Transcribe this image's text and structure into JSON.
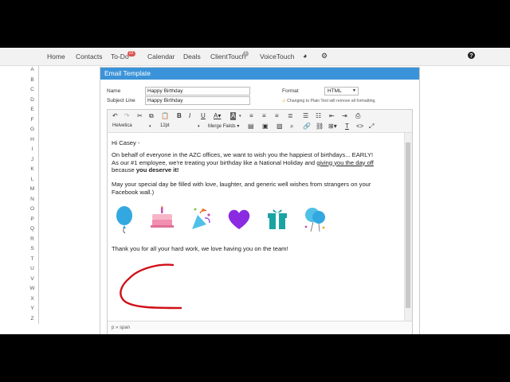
{
  "nav": {
    "items": [
      {
        "label": "Home"
      },
      {
        "label": "Contacts"
      },
      {
        "label": "To-Do",
        "badge": "22"
      },
      {
        "label": "Calendar"
      },
      {
        "label": "Deals"
      },
      {
        "label": "ClientTouch",
        "badge": "1"
      },
      {
        "label": "VoiceTouch"
      }
    ],
    "icons": [
      "pie-chart-icon",
      "gear-icon",
      "help-icon"
    ]
  },
  "alphabet": [
    "A",
    "B",
    "C",
    "D",
    "E",
    "F",
    "G",
    "H",
    "I",
    "J",
    "K",
    "L",
    "M",
    "N",
    "O",
    "P",
    "Q",
    "R",
    "S",
    "T",
    "U",
    "V",
    "W",
    "X",
    "Y",
    "Z"
  ],
  "template": {
    "header": "Email Template",
    "name_label": "Name",
    "name_value": "Happy Birthday",
    "subject_label": "Subject Line",
    "subject_value": "Happy Birthday",
    "format_label": "Format",
    "format_value": "HTML",
    "warning": "Changing to Plain Text will remove all formatting."
  },
  "toolbar": {
    "font": "Helvetica",
    "size": "12pt",
    "merge": "Merge Fields"
  },
  "body": {
    "greeting": "Hi Casey -",
    "p1_a": "On behalf of everyone in the AZC offices, we want to wish you the happiest of birthdays... EARLY!",
    "p1_b": "As our #1 employee, we're treating your birthday like a National Holiday and ",
    "p1_link": "giving you the day off",
    "p1_c": "because ",
    "p1_bold": "you deserve it!",
    "p2": "May your special day be filled with love, laughter, and generic well wishes from strangers on your Facebook wall.)",
    "closing": "Thank you for all your hard work, we love having you on the team!"
  },
  "status_path": "p » span",
  "colors": {
    "header": "#3a93d8",
    "balloon": "#33a8e0",
    "heart": "#8a2be2",
    "gift": "#1aa3a3",
    "annotation": "#d01018"
  }
}
